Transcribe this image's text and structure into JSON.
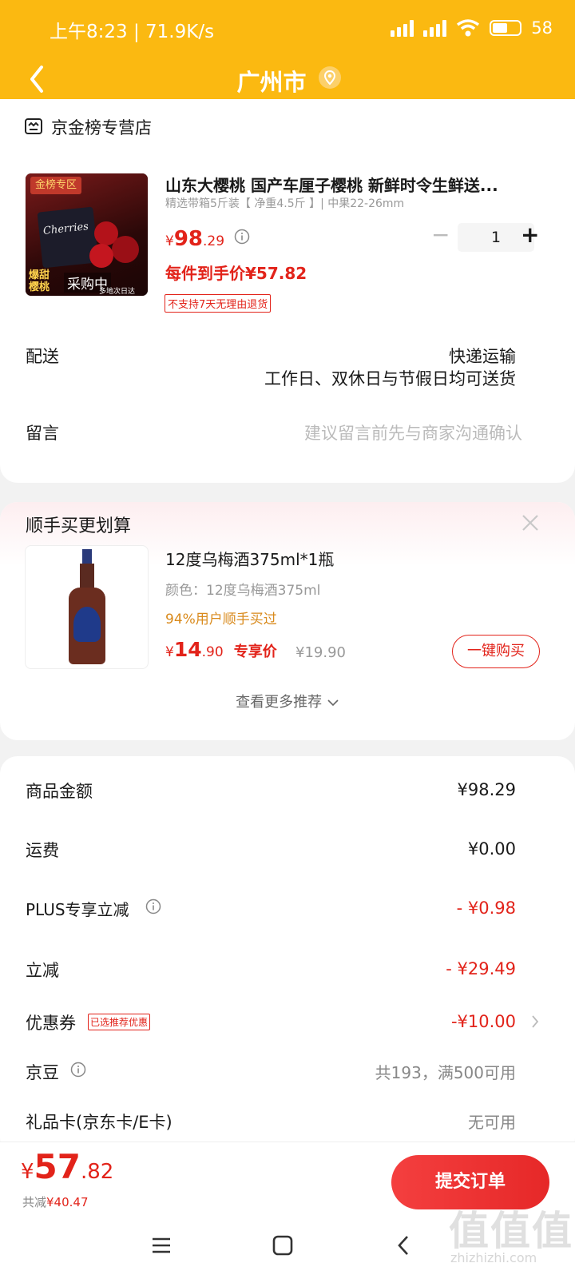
{
  "status_bar": {
    "time": "上午8:23 | 71.9K/s",
    "battery": "58"
  },
  "header": {
    "title": "广州市"
  },
  "store": {
    "name": "京金榜专营店"
  },
  "product": {
    "badge": "金榜专区",
    "box_text": "Cherries",
    "tag_line1": "爆甜",
    "tag_line2": "樱桃",
    "overlay": "采购中",
    "sub_caption": "多地次日达",
    "title": "山东大樱桃 国产车厘子樱桃 新鲜时令生鲜送...",
    "spec": "精选带箱5斤装【 净重4.5斤 】| 中果22-26mm",
    "price_symbol": "¥",
    "price_int": "98",
    "price_dec": ".29",
    "final_price": "每件到手价¥57.82",
    "return_policy": "不支持7天无理由退货",
    "quantity": "1",
    "minus": "−",
    "plus": "+"
  },
  "delivery": {
    "label": "配送",
    "method": "快递运输",
    "note": "工作日、双休日与节假日均可送货"
  },
  "message": {
    "label": "留言",
    "placeholder": "建议留言前先与商家沟通确认"
  },
  "addon": {
    "title": "顺手买更划算",
    "item_title": "12度乌梅酒375ml*1瓶",
    "item_spec": "颜色：12度乌梅酒375ml",
    "item_social": "94%用户顺手买过",
    "price_symbol": "¥",
    "price_int": "14",
    "price_dec": ".90",
    "price_tag": "专享价",
    "original_price": "¥19.90",
    "buy_button": "一键购买",
    "more": "查看更多推荐"
  },
  "summary": {
    "rows": [
      {
        "label": "商品金额",
        "value": "¥98.29"
      },
      {
        "label": "运费",
        "value": "¥0.00"
      },
      {
        "label": "PLUS专享立减",
        "value": "- ¥0.98"
      },
      {
        "label": "立减",
        "value": "- ¥29.49"
      },
      {
        "label": "优惠券",
        "badge": "已选推荐优惠",
        "value": "-¥10.00"
      },
      {
        "label": "京豆",
        "value": "共193，满500可用"
      },
      {
        "label": "礼品卡(京东卡/E卡)",
        "value": "无可用"
      }
    ]
  },
  "checkout": {
    "price_symbol": "¥",
    "price_int": "57",
    "price_dec": ".82",
    "saved_label": "共减",
    "saved_value": "¥40.47",
    "submit": "提交订单"
  },
  "watermark": {
    "text": "值值值",
    "url": "zhizhizhi.com"
  },
  "colors": {
    "header": "#fbb911",
    "accent": "#e2231a",
    "badge_text": "#e2231a",
    "social_orange": "#d98a1c"
  }
}
